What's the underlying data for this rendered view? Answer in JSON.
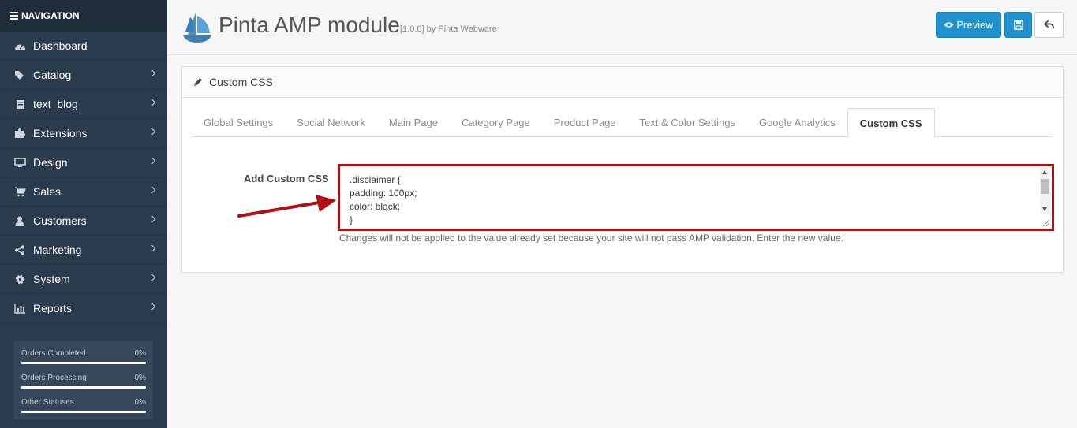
{
  "sidebar": {
    "header": "NAVIGATION",
    "items": [
      {
        "label": "Dashboard",
        "icon": "dashboard-icon",
        "has_children": false
      },
      {
        "label": "Catalog",
        "icon": "tags-icon",
        "has_children": true
      },
      {
        "label": "text_blog",
        "icon": "book-icon",
        "has_children": true
      },
      {
        "label": "Extensions",
        "icon": "puzzle-icon",
        "has_children": true
      },
      {
        "label": "Design",
        "icon": "monitor-icon",
        "has_children": true
      },
      {
        "label": "Sales",
        "icon": "cart-icon",
        "has_children": true
      },
      {
        "label": "Customers",
        "icon": "user-icon",
        "has_children": true
      },
      {
        "label": "Marketing",
        "icon": "share-icon",
        "has_children": true
      },
      {
        "label": "System",
        "icon": "gear-icon",
        "has_children": true
      },
      {
        "label": "Reports",
        "icon": "bar-chart-icon",
        "has_children": true
      }
    ],
    "stats": [
      {
        "label": "Orders Completed",
        "value": "0%",
        "fill": 0
      },
      {
        "label": "Orders Processing",
        "value": "0%",
        "fill": 0
      },
      {
        "label": "Other Statuses",
        "value": "0%",
        "fill": 0
      }
    ]
  },
  "header": {
    "title": "Pinta AMP module",
    "subtitle": "[1.0.0] by Pinta Webware",
    "preview_label": "Preview"
  },
  "panel": {
    "heading": "Custom CSS",
    "tabs": [
      {
        "label": "Global Settings",
        "active": false
      },
      {
        "label": "Social Network",
        "active": false
      },
      {
        "label": "Main Page",
        "active": false
      },
      {
        "label": "Category Page",
        "active": false
      },
      {
        "label": "Product Page",
        "active": false
      },
      {
        "label": "Text & Color Settings",
        "active": false
      },
      {
        "label": "Google Analytics",
        "active": false
      },
      {
        "label": "Custom CSS",
        "active": true
      }
    ],
    "field_label": "Add Custom CSS",
    "css_value": ".disclaimer {\npadding: 100px;\ncolor: black;\n}",
    "help_text": "Changes will not be applied to the value already set because your site will not pass AMP validation. Enter the new value."
  },
  "colors": {
    "sidebar_bg": "#2a3b4d",
    "primary": "#1e91cf",
    "highlight": "#b00f16"
  }
}
